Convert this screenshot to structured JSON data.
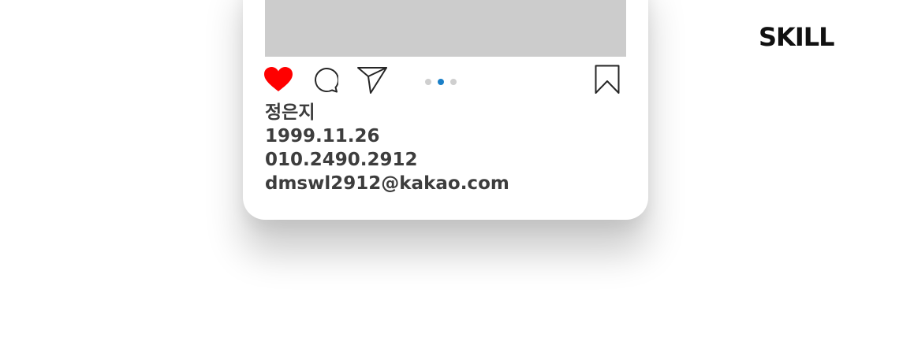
{
  "header": {
    "section_title": "SKILL"
  },
  "post": {
    "carousel": {
      "page_count": 3,
      "active_index": 1,
      "active_color": "#1a7fc7",
      "inactive_color": "#cfcfcf"
    },
    "actions": {
      "like_icon": "heart-icon",
      "like_color": "#ff0000",
      "comment_icon": "comment-icon",
      "share_icon": "paper-plane-icon",
      "save_icon": "bookmark-icon"
    },
    "profile": {
      "name": "정은지",
      "birthdate": "1999.11.26",
      "phone": "010.2490.2912",
      "email": "dmswl2912@kakao.com"
    }
  }
}
